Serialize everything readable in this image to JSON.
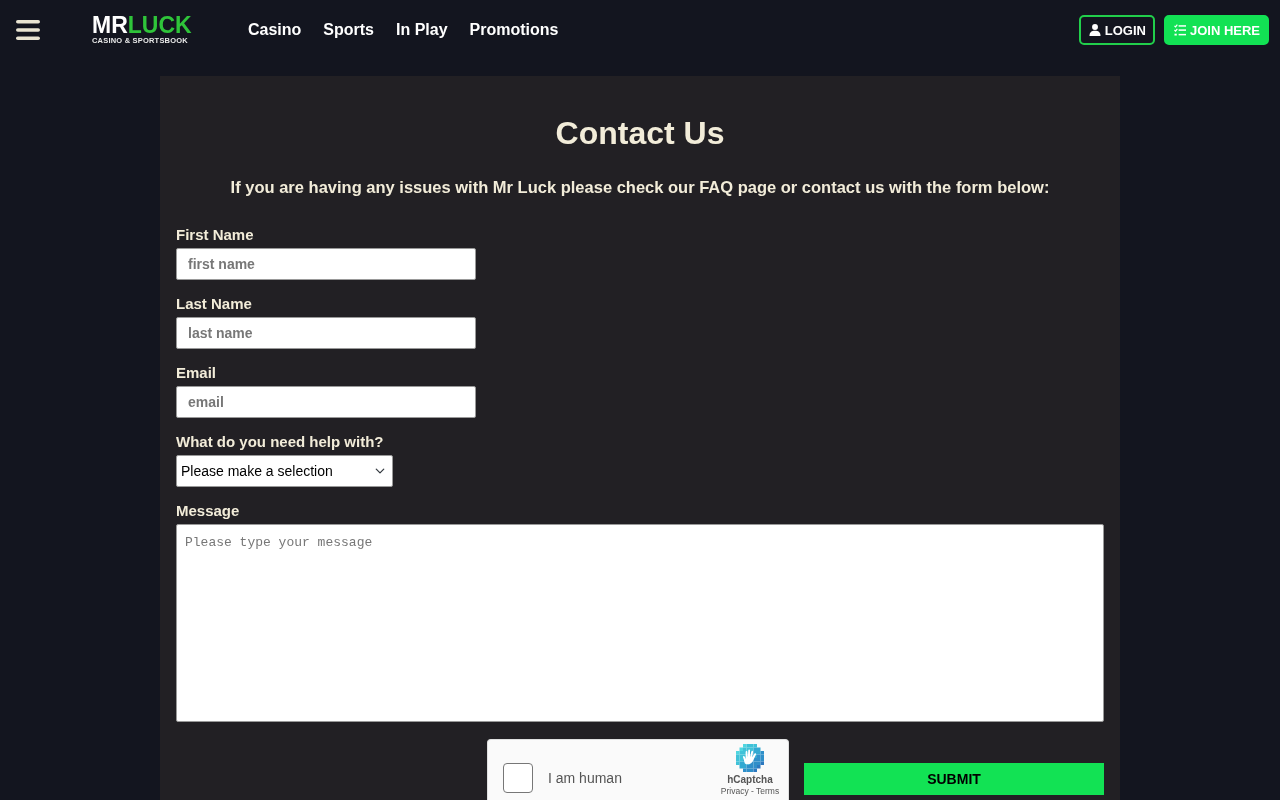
{
  "header": {
    "logo": {
      "wordmark_left": "MR",
      "wordmark_right": "LUCK",
      "tagline": "CASINO & SPORTSBOOK"
    },
    "nav_links": [
      {
        "label": "Casino"
      },
      {
        "label": "Sports"
      },
      {
        "label": "In Play"
      },
      {
        "label": "Promotions"
      }
    ],
    "buttons": [
      {
        "label": "LOGIN",
        "kind": "outline"
      },
      {
        "label": "JOIN HERE",
        "kind": "filled"
      }
    ]
  },
  "page": {
    "title": "Contact Us",
    "intro": "If you are having any issues with Mr Luck please check our FAQ page or contact us with the form below:"
  },
  "form": {
    "fields": [
      {
        "label": "First Name",
        "kind": "text",
        "placeholder": "first name"
      },
      {
        "label": "Last Name",
        "kind": "text",
        "placeholder": "last name"
      },
      {
        "label": "Email",
        "kind": "text",
        "placeholder": "email"
      },
      {
        "label": "What do you need help with?",
        "kind": "select",
        "value": "Please make a selection"
      },
      {
        "label": "Message",
        "kind": "textarea",
        "placeholder": "Please type your message"
      }
    ],
    "captcha": {
      "label": "I am human",
      "checked": false,
      "brand": "hCaptcha",
      "links": "Privacy - Terms"
    },
    "submit": "SUBMIT"
  }
}
